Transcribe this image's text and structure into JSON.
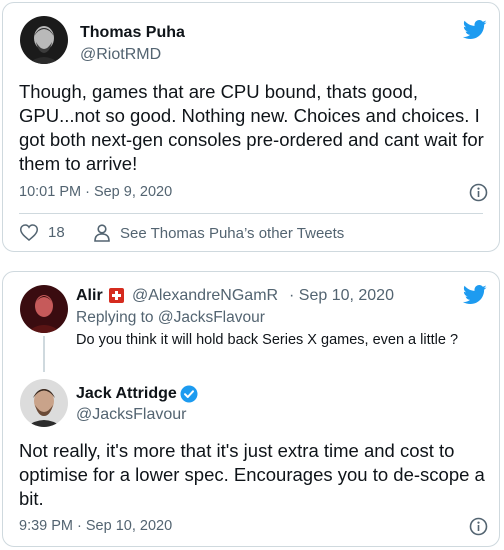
{
  "tweet_main": {
    "author_name": "Thomas Puha",
    "author_handle": "@RiotRMD",
    "text": "Though, games that are CPU bound, thats good, GPU...not so good. Nothing new. Choices and choices. I got both next-gen consoles pre-ordered and cant wait for them to arrive!",
    "timestamp": "10:01 PM · Sep 9, 2020",
    "like_count": "18",
    "see_more_label": "See Thomas Puha’s other Tweets"
  },
  "tweet_reply": {
    "parent": {
      "author_name": "Alir",
      "author_handle": "@AlexandreNGamR",
      "date": "· Sep 10, 2020",
      "replying_to": "Replying to @JacksFlavour",
      "text": "Do you think it will hold back Series X games, even a little ?"
    },
    "reply": {
      "author_name": "Jack Attridge",
      "author_handle": "@JacksFlavour",
      "text": "Not really, it's more that it's just extra time and cost to optimise for a lower spec. Encourages you to de-scope a bit.",
      "timestamp": "9:39 PM · Sep 10, 2020"
    }
  },
  "colors": {
    "twitter_blue": "#1d9bf0",
    "verified_badge": "#1d9bf0",
    "flag_red": "#d52b1e"
  },
  "icons": [
    "twitter-bird-icon",
    "info-icon",
    "heart-icon",
    "person-icon",
    "verified-badge-icon",
    "swiss-flag-icon"
  ]
}
